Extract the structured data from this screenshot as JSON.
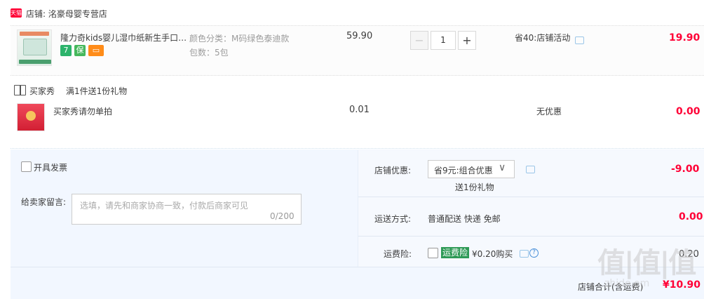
{
  "shop": {
    "badge": "天猫",
    "label": "店铺: 洺豪母婴专营店"
  },
  "item1": {
    "title": "隆力奇kids婴儿湿巾纸新生手口…",
    "sku_color": "颜色分类：M码绿色泰迪款",
    "sku_count": "包数：5包",
    "price": "59.90",
    "qty": "1",
    "minus": "−",
    "plus": "+",
    "promo": "省40:店铺活动",
    "subtotal": "19.90",
    "badges": [
      "7",
      "保",
      "card"
    ]
  },
  "gift": {
    "label": "买家秀",
    "desc": "满1件送1份礼物",
    "title": "买家秀请勿单拍",
    "price": "0.01",
    "promo": "无优惠",
    "subtotal": "0.00"
  },
  "invoice": {
    "label": "开具发票"
  },
  "message": {
    "label": "给卖家留言:",
    "placeholder": "选填，请先和商家协商一致，付款后商家可见",
    "count": "0/200"
  },
  "shop_discount": {
    "label": "店铺优惠:",
    "selected": "省9元:组合优惠",
    "gift_note": "送1份礼物",
    "value": "-9.00"
  },
  "shipping": {
    "label": "运送方式:",
    "value": "普通配送 快递 免邮",
    "cost": "0.00"
  },
  "insurance": {
    "label": "运费险:",
    "badge": "运费险",
    "price": "¥0.20购买",
    "cost": "0.20"
  },
  "total": {
    "label": "店铺合计(含运费)",
    "value": "¥10.90"
  },
  "watermark": {
    "big": "值|值|值",
    "small": "zhide.om"
  }
}
